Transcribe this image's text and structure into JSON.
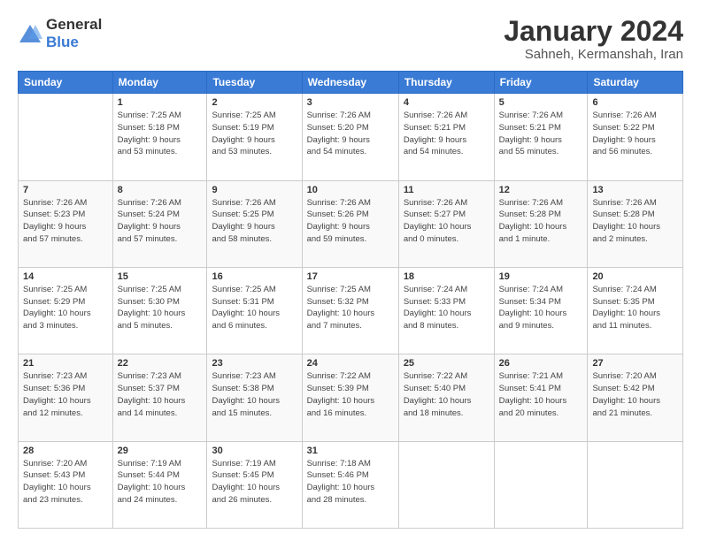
{
  "logo": {
    "general": "General",
    "blue": "Blue"
  },
  "header": {
    "month": "January 2024",
    "location": "Sahneh, Kermanshah, Iran"
  },
  "weekdays": [
    "Sunday",
    "Monday",
    "Tuesday",
    "Wednesday",
    "Thursday",
    "Friday",
    "Saturday"
  ],
  "weeks": [
    [
      {
        "day": "",
        "info": ""
      },
      {
        "day": "1",
        "info": "Sunrise: 7:25 AM\nSunset: 5:18 PM\nDaylight: 9 hours\nand 53 minutes."
      },
      {
        "day": "2",
        "info": "Sunrise: 7:25 AM\nSunset: 5:19 PM\nDaylight: 9 hours\nand 53 minutes."
      },
      {
        "day": "3",
        "info": "Sunrise: 7:26 AM\nSunset: 5:20 PM\nDaylight: 9 hours\nand 54 minutes."
      },
      {
        "day": "4",
        "info": "Sunrise: 7:26 AM\nSunset: 5:21 PM\nDaylight: 9 hours\nand 54 minutes."
      },
      {
        "day": "5",
        "info": "Sunrise: 7:26 AM\nSunset: 5:21 PM\nDaylight: 9 hours\nand 55 minutes."
      },
      {
        "day": "6",
        "info": "Sunrise: 7:26 AM\nSunset: 5:22 PM\nDaylight: 9 hours\nand 56 minutes."
      }
    ],
    [
      {
        "day": "7",
        "info": "Sunrise: 7:26 AM\nSunset: 5:23 PM\nDaylight: 9 hours\nand 57 minutes."
      },
      {
        "day": "8",
        "info": "Sunrise: 7:26 AM\nSunset: 5:24 PM\nDaylight: 9 hours\nand 57 minutes."
      },
      {
        "day": "9",
        "info": "Sunrise: 7:26 AM\nSunset: 5:25 PM\nDaylight: 9 hours\nand 58 minutes."
      },
      {
        "day": "10",
        "info": "Sunrise: 7:26 AM\nSunset: 5:26 PM\nDaylight: 9 hours\nand 59 minutes."
      },
      {
        "day": "11",
        "info": "Sunrise: 7:26 AM\nSunset: 5:27 PM\nDaylight: 10 hours\nand 0 minutes."
      },
      {
        "day": "12",
        "info": "Sunrise: 7:26 AM\nSunset: 5:28 PM\nDaylight: 10 hours\nand 1 minute."
      },
      {
        "day": "13",
        "info": "Sunrise: 7:26 AM\nSunset: 5:28 PM\nDaylight: 10 hours\nand 2 minutes."
      }
    ],
    [
      {
        "day": "14",
        "info": "Sunrise: 7:25 AM\nSunset: 5:29 PM\nDaylight: 10 hours\nand 3 minutes."
      },
      {
        "day": "15",
        "info": "Sunrise: 7:25 AM\nSunset: 5:30 PM\nDaylight: 10 hours\nand 5 minutes."
      },
      {
        "day": "16",
        "info": "Sunrise: 7:25 AM\nSunset: 5:31 PM\nDaylight: 10 hours\nand 6 minutes."
      },
      {
        "day": "17",
        "info": "Sunrise: 7:25 AM\nSunset: 5:32 PM\nDaylight: 10 hours\nand 7 minutes."
      },
      {
        "day": "18",
        "info": "Sunrise: 7:24 AM\nSunset: 5:33 PM\nDaylight: 10 hours\nand 8 minutes."
      },
      {
        "day": "19",
        "info": "Sunrise: 7:24 AM\nSunset: 5:34 PM\nDaylight: 10 hours\nand 9 minutes."
      },
      {
        "day": "20",
        "info": "Sunrise: 7:24 AM\nSunset: 5:35 PM\nDaylight: 10 hours\nand 11 minutes."
      }
    ],
    [
      {
        "day": "21",
        "info": "Sunrise: 7:23 AM\nSunset: 5:36 PM\nDaylight: 10 hours\nand 12 minutes."
      },
      {
        "day": "22",
        "info": "Sunrise: 7:23 AM\nSunset: 5:37 PM\nDaylight: 10 hours\nand 14 minutes."
      },
      {
        "day": "23",
        "info": "Sunrise: 7:23 AM\nSunset: 5:38 PM\nDaylight: 10 hours\nand 15 minutes."
      },
      {
        "day": "24",
        "info": "Sunrise: 7:22 AM\nSunset: 5:39 PM\nDaylight: 10 hours\nand 16 minutes."
      },
      {
        "day": "25",
        "info": "Sunrise: 7:22 AM\nSunset: 5:40 PM\nDaylight: 10 hours\nand 18 minutes."
      },
      {
        "day": "26",
        "info": "Sunrise: 7:21 AM\nSunset: 5:41 PM\nDaylight: 10 hours\nand 20 minutes."
      },
      {
        "day": "27",
        "info": "Sunrise: 7:20 AM\nSunset: 5:42 PM\nDaylight: 10 hours\nand 21 minutes."
      }
    ],
    [
      {
        "day": "28",
        "info": "Sunrise: 7:20 AM\nSunset: 5:43 PM\nDaylight: 10 hours\nand 23 minutes."
      },
      {
        "day": "29",
        "info": "Sunrise: 7:19 AM\nSunset: 5:44 PM\nDaylight: 10 hours\nand 24 minutes."
      },
      {
        "day": "30",
        "info": "Sunrise: 7:19 AM\nSunset: 5:45 PM\nDaylight: 10 hours\nand 26 minutes."
      },
      {
        "day": "31",
        "info": "Sunrise: 7:18 AM\nSunset: 5:46 PM\nDaylight: 10 hours\nand 28 minutes."
      },
      {
        "day": "",
        "info": ""
      },
      {
        "day": "",
        "info": ""
      },
      {
        "day": "",
        "info": ""
      }
    ]
  ]
}
